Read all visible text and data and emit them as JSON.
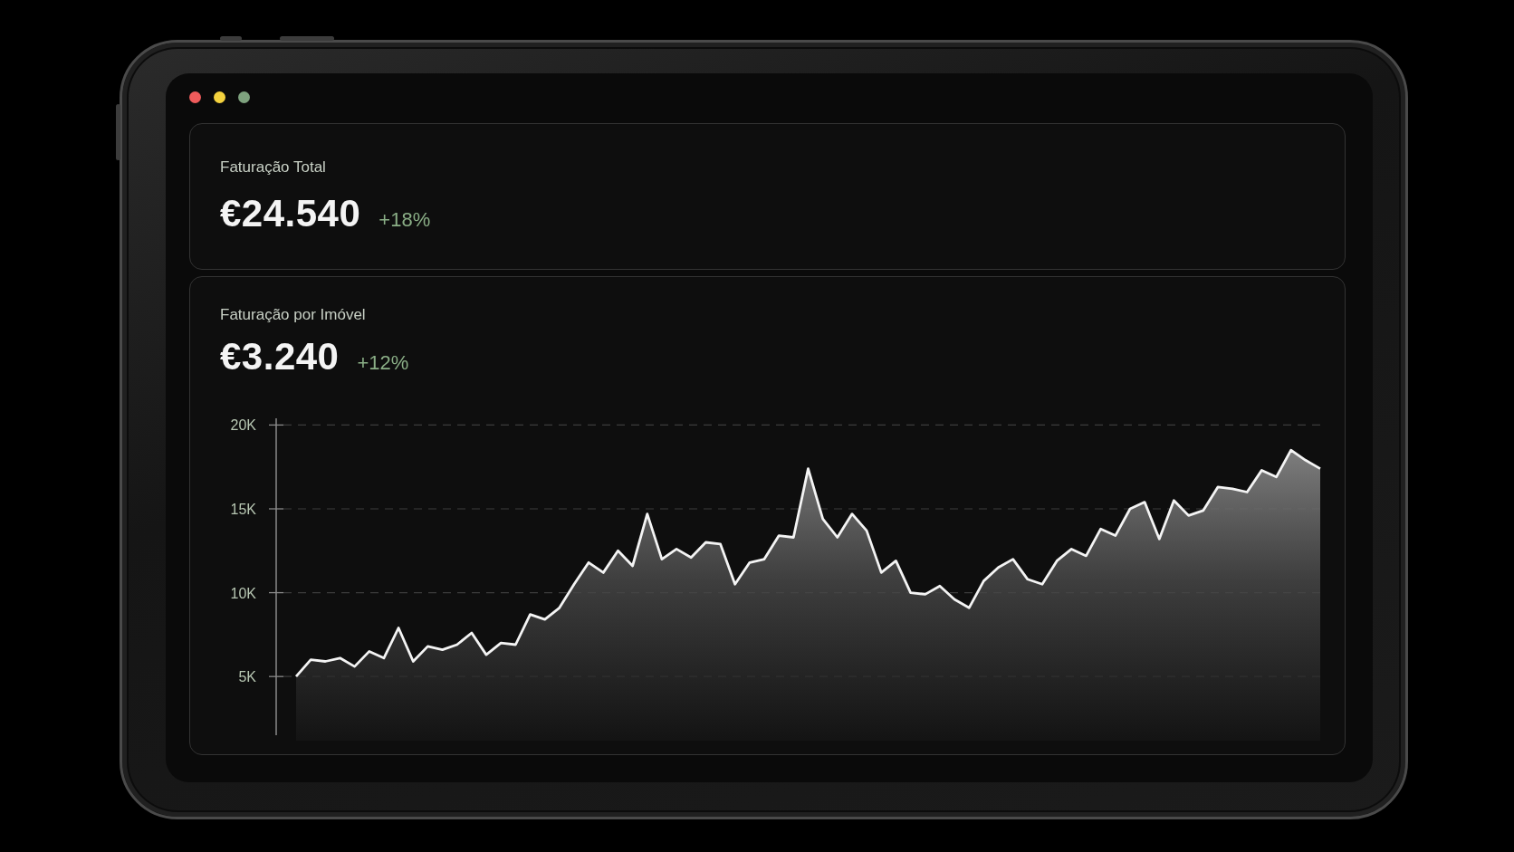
{
  "window_controls": [
    {
      "color": "#ef5b5b"
    },
    {
      "color": "#f4d23e"
    },
    {
      "color": "#7ea27e"
    }
  ],
  "cards": [
    {
      "title": "Faturação Total",
      "value": "€24.540",
      "change": "+18%"
    },
    {
      "title": "Faturação por Imóvel",
      "value": "€3.240",
      "change": "+12%",
      "chart_data": {
        "type": "area",
        "grid": true,
        "ylim": [
          1500,
          20400
        ],
        "yticks": [
          {
            "value": 5000,
            "label": "5K"
          },
          {
            "value": 10000,
            "label": "10K"
          },
          {
            "value": 15000,
            "label": "15K"
          },
          {
            "value": 20000,
            "label": "20K"
          }
        ],
        "values": [
          5000,
          6000,
          5900,
          6100,
          5600,
          6500,
          6100,
          7900,
          5900,
          6800,
          6600,
          6900,
          7600,
          6300,
          7000,
          6900,
          8700,
          8400,
          9100,
          10500,
          11800,
          11200,
          12500,
          11600,
          14700,
          12000,
          12600,
          12100,
          13000,
          12900,
          10500,
          11800,
          12000,
          13400,
          13300,
          17400,
          14400,
          13300,
          14700,
          13700,
          11200,
          11900,
          10000,
          9900,
          10400,
          9600,
          9100,
          10700,
          11500,
          12000,
          10800,
          10500,
          11900,
          12600,
          12200,
          13800,
          13400,
          15000,
          15400,
          13200,
          15500,
          14600,
          14900,
          16300,
          16200,
          16000,
          17300,
          16900,
          18500,
          17900,
          17400
        ]
      }
    }
  ]
}
